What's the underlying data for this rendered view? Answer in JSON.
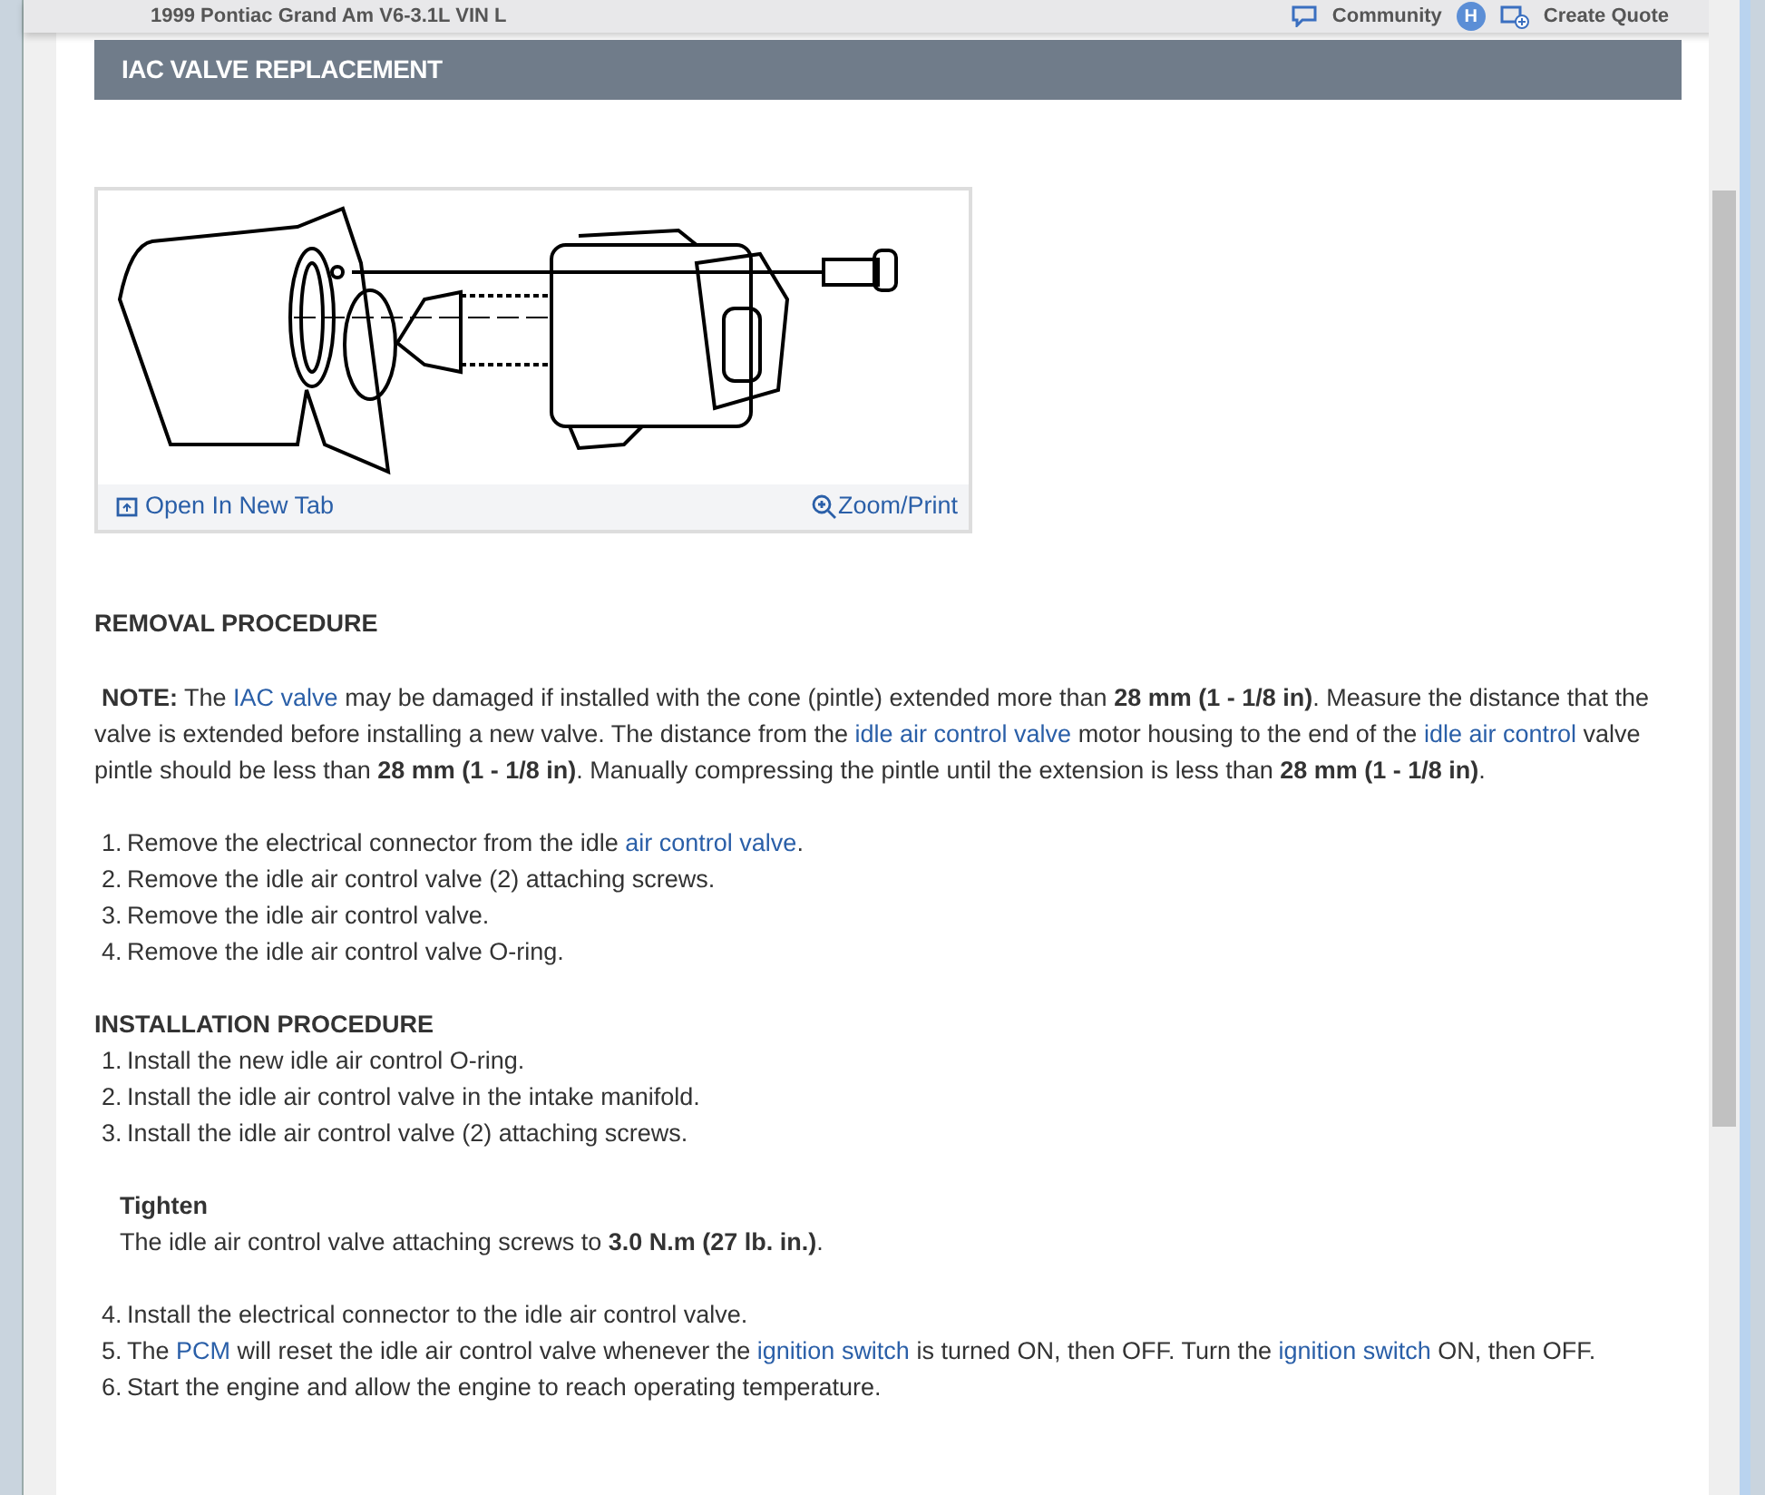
{
  "header": {
    "vehicle": "1999 Pontiac Grand Am V6-3.1L VIN L",
    "community": "Community",
    "avatar": "H",
    "create_quote": "Create Quote"
  },
  "section_title": "IAC VALVE REPLACEMENT",
  "figure": {
    "open_link": "Open In New Tab",
    "zoom_link": "Zoom/Print"
  },
  "blocks": [
    {
      "kind": "heading",
      "text": "REMOVAL PROCEDURE"
    },
    {
      "kind": "para",
      "segments": [
        {
          "kind": "bold",
          "text": "NOTE:"
        },
        {
          "kind": "text",
          "text": " The "
        },
        {
          "kind": "link",
          "text": "IAC valve"
        },
        {
          "kind": "text",
          "text": " may be damaged if installed with the cone (pintle) extended more than "
        },
        {
          "kind": "bold",
          "text": "28 mm (1 - 1/8 in)"
        },
        {
          "kind": "text",
          "text": ". Measure the distance that the valve is extended before installing a new valve. The distance from the "
        },
        {
          "kind": "link",
          "text": "idle air control valve"
        },
        {
          "kind": "text",
          "text": " motor housing to the end of the "
        },
        {
          "kind": "link",
          "text": "idle air control"
        },
        {
          "kind": "text",
          "text": " valve pintle should be less than "
        },
        {
          "kind": "bold",
          "text": "28 mm (1 - 1/8 in)"
        },
        {
          "kind": "text",
          "text": ". Manually compressing the pintle until the extension is less than "
        },
        {
          "kind": "bold",
          "text": "28 mm (1 - 1/8 in)"
        },
        {
          "kind": "text",
          "text": "."
        }
      ]
    },
    {
      "kind": "steps",
      "items": [
        {
          "number": "1.",
          "segments": [
            {
              "kind": "text",
              "text": "Remove the electrical connector from the idle "
            },
            {
              "kind": "link",
              "text": "air control valve"
            },
            {
              "kind": "text",
              "text": "."
            }
          ]
        },
        {
          "number": "2.",
          "segments": [
            {
              "kind": "text",
              "text": "Remove the idle air control valve (2) attaching screws."
            }
          ]
        },
        {
          "number": "3.",
          "segments": [
            {
              "kind": "text",
              "text": "Remove the idle air control valve."
            }
          ]
        },
        {
          "number": "4.",
          "segments": [
            {
              "kind": "text",
              "text": "Remove the idle air control valve O-ring."
            }
          ]
        }
      ]
    },
    {
      "kind": "heading",
      "text": "INSTALLATION PROCEDURE"
    },
    {
      "kind": "steps",
      "items": [
        {
          "number": "1.",
          "segments": [
            {
              "kind": "text",
              "text": "Install the new idle air control O-ring."
            }
          ]
        },
        {
          "number": "2.",
          "segments": [
            {
              "kind": "text",
              "text": "Install the idle air control valve in the intake manifold."
            }
          ]
        },
        {
          "number": "3.",
          "segments": [
            {
              "kind": "text",
              "text": "Install the idle air control valve (2) attaching screws."
            }
          ]
        }
      ]
    },
    {
      "kind": "spec",
      "title": "Tighten",
      "segments": [
        {
          "kind": "text",
          "text": "The idle air control valve attaching screws to "
        },
        {
          "kind": "bold",
          "text": "3.0 N.m (27 lb. in.)"
        },
        {
          "kind": "text",
          "text": "."
        }
      ]
    },
    {
      "kind": "steps",
      "items": [
        {
          "number": "4.",
          "segments": [
            {
              "kind": "text",
              "text": "Install the electrical connector to the idle air control valve."
            }
          ]
        },
        {
          "number": "5.",
          "segments": [
            {
              "kind": "text",
              "text": "The "
            },
            {
              "kind": "link",
              "text": "PCM"
            },
            {
              "kind": "text",
              "text": " will reset the idle air control valve whenever the "
            },
            {
              "kind": "link",
              "text": "ignition switch"
            },
            {
              "kind": "text",
              "text": " is turned ON, then OFF. Turn the "
            },
            {
              "kind": "link",
              "text": "ignition switch"
            },
            {
              "kind": "text",
              "text": " ON, then OFF."
            }
          ]
        },
        {
          "number": "6.",
          "segments": [
            {
              "kind": "text",
              "text": "Start the engine and allow the engine to reach operating temperature."
            }
          ]
        }
      ]
    }
  ]
}
